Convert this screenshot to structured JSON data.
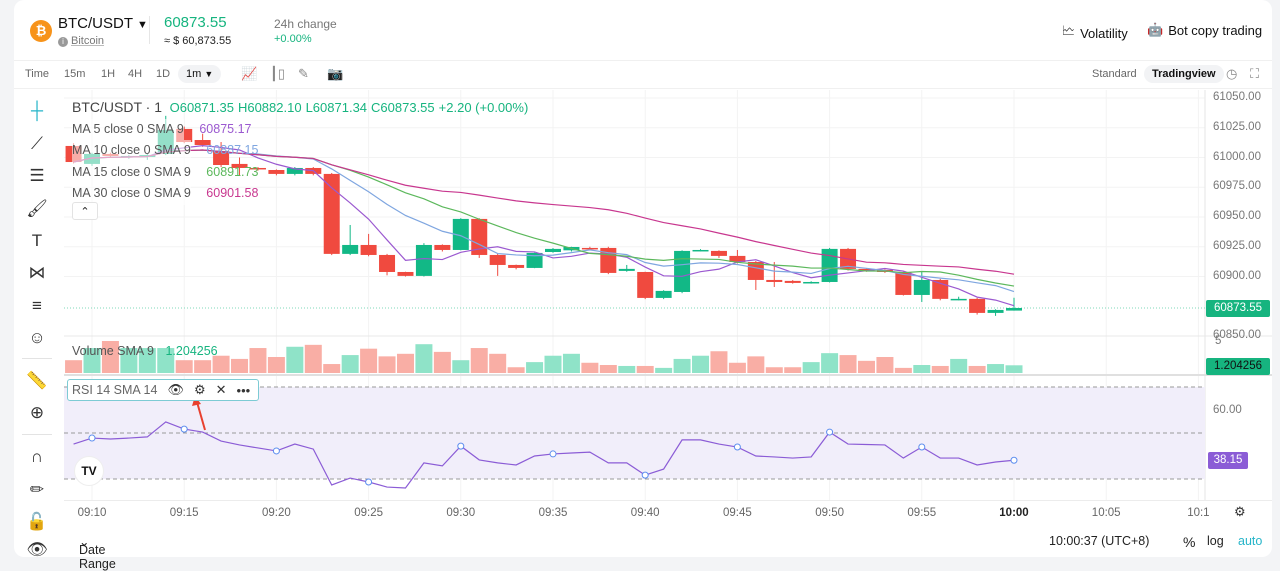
{
  "header": {
    "coin_icon": "bitcoin-icon",
    "pair": "BTC/USDT",
    "coin_name": "Bitcoin",
    "price": "60873.55",
    "price_usd": "≈ $ 60,873.55",
    "change_label": "24h change",
    "change_value": "+0.00%",
    "volatility": "Volatility",
    "bot_copy": "Bot copy trading"
  },
  "toolbar": {
    "intervals": [
      "Time",
      "15m",
      "1H",
      "4H",
      "1D"
    ],
    "selected_interval": "1m",
    "views": [
      "Standard",
      "Tradingview"
    ],
    "active_view": "Tradingview"
  },
  "legend": {
    "title": "BTC/USDT · 1",
    "o": "O60871.35",
    "h": "H60882.10",
    "l": "L60871.34",
    "c": "C60873.55",
    "chg": "+2.20 (+0.00%)",
    "ma": [
      {
        "label": "MA 5 close 0 SMA 9",
        "value": "60875.17",
        "color": "#9b59d0",
        "period": 5
      },
      {
        "label": "MA 10 close 0 SMA 9",
        "value": "60887.15",
        "color": "#7fa6e0",
        "period": 10
      },
      {
        "label": "MA 15 close 0 SMA 9",
        "value": "60891.73",
        "color": "#5cb85c",
        "period": 15
      },
      {
        "label": "MA 30 close 0 SMA 9",
        "value": "60901.58",
        "color": "#c8378f",
        "period": 30
      }
    ]
  },
  "volume": {
    "label": "Volume SMA 9",
    "value": "1.204256",
    "axis_label": "5"
  },
  "rsi": {
    "label": "RSI 14 SMA 14",
    "value": "38.15",
    "axis_label": "60.00",
    "bands": [
      70,
      50,
      30
    ]
  },
  "price_axis": [
    "61050.00",
    "61025.00",
    "61000.00",
    "60975.00",
    "60950.00",
    "60925.00",
    "60900.00",
    "60850.00"
  ],
  "current_price_tag": "60873.55",
  "time_axis": [
    "09:10",
    "09:15",
    "09:20",
    "09:25",
    "09:30",
    "09:35",
    "09:40",
    "09:45",
    "09:50",
    "09:55",
    "10:00",
    "10:05",
    "10:1"
  ],
  "bottom": {
    "date_range": "Date Range",
    "clock": "10:00:37 (UTC+8)",
    "percent": "%",
    "log": "log",
    "auto": "auto"
  },
  "colors": {
    "up": "#12b886",
    "down": "#f04a3f",
    "accent": "#26b5c9",
    "rsi": "#8b5cd6"
  },
  "chart_data": {
    "type": "candlestick",
    "columns": [
      "time",
      "open",
      "high",
      "low",
      "close",
      "volume",
      "rsi"
    ],
    "candles": [
      [
        "09:09",
        61009.7,
        61012,
        60995,
        60996.2,
        2.0,
        45.2
      ],
      [
        "09:10",
        60994.6,
        61004,
        60993,
        61003,
        3.9,
        47.8
      ],
      [
        "09:11",
        61003,
        61004,
        61000,
        61001.3,
        5.0,
        47.4
      ],
      [
        "09:12",
        61000.4,
        61002,
        60999,
        61001.3,
        3.9,
        47.8
      ],
      [
        "09:13",
        61000.4,
        61003,
        60998,
        61002.1,
        3.9,
        48.3
      ],
      [
        "09:14",
        61003,
        61035,
        61002,
        61023.1,
        3.9,
        54.8
      ],
      [
        "09:15",
        61024,
        61026,
        61012,
        61013,
        2.0,
        51.7
      ],
      [
        "09:16",
        61014.7,
        61020,
        61009,
        61010.5,
        2.0,
        50.4
      ],
      [
        "09:17",
        61005.5,
        61013,
        60992,
        60993.7,
        2.7,
        46.5
      ],
      [
        "09:18",
        60994.6,
        61000,
        60985.3,
        60991.2,
        2.2,
        44.8
      ],
      [
        "09:19",
        60991.2,
        60992,
        60989,
        60990,
        3.9,
        43.5
      ],
      [
        "09:20",
        60989.5,
        60990,
        60985,
        60986.2,
        2.5,
        42.2
      ],
      [
        "09:21",
        60986.2,
        60992,
        60985,
        60991.2,
        4.1,
        45.2
      ],
      [
        "09:22",
        60991.2,
        60992,
        60985,
        60986.2,
        4.4,
        43.0
      ],
      [
        "09:23",
        60986.2,
        60987,
        60918,
        60919,
        1.4,
        27.4
      ],
      [
        "09:24",
        60919,
        60943.3,
        60918,
        60926.5,
        2.8,
        30.4
      ],
      [
        "09:25",
        60926.5,
        60935.8,
        60917,
        60918.1,
        3.8,
        28.7
      ],
      [
        "09:26",
        60918.1,
        60919,
        60901,
        60903.8,
        2.6,
        26.5
      ],
      [
        "09:27",
        60903.8,
        60904,
        60900,
        60900.5,
        3.0,
        26.1
      ],
      [
        "09:28",
        60900.5,
        60928,
        60900,
        60926.5,
        4.5,
        37.0
      ],
      [
        "09:29",
        60926.5,
        60927,
        60921,
        60922.3,
        3.3,
        35.7
      ],
      [
        "09:30",
        60922.3,
        60949,
        60922,
        60948.4,
        2.0,
        44.3
      ],
      [
        "09:31",
        60948.4,
        60949,
        60915.6,
        60918.1,
        3.9,
        38.3
      ],
      [
        "09:32",
        60918.1,
        60919,
        60900.5,
        60909.7,
        3.0,
        37.0
      ],
      [
        "09:33",
        60909.7,
        60910,
        60906,
        60907.2,
        0.9,
        36.1
      ],
      [
        "09:34",
        60907.2,
        60920,
        60907,
        60919.8,
        1.7,
        40.0
      ],
      [
        "09:35",
        60920.6,
        60924,
        60920,
        60923.2,
        2.7,
        40.9
      ],
      [
        "09:36",
        60922,
        60925,
        60921,
        60924.8,
        3.0,
        41.3
      ],
      [
        "09:37",
        60924,
        60925,
        60923,
        60923.5,
        1.6,
        41.7
      ],
      [
        "09:38",
        60924,
        60925,
        60902,
        60903,
        1.25,
        37.0
      ],
      [
        "09:39",
        60904.7,
        60909.7,
        60904,
        60906.4,
        1.1,
        37.0
      ],
      [
        "09:40",
        60903.8,
        60904,
        60881,
        60882,
        1.1,
        31.7
      ],
      [
        "09:41",
        60882,
        60888.5,
        60881,
        60887.9,
        0.8,
        34.3
      ],
      [
        "09:42",
        60887,
        60922,
        60886,
        60921.5,
        2.2,
        47.0
      ],
      [
        "09:43",
        60921.5,
        60923,
        60921,
        60922.3,
        2.7,
        47.0
      ],
      [
        "09:44",
        60921.5,
        60922,
        60915.6,
        60917.3,
        3.4,
        45.2
      ],
      [
        "09:45",
        60917.3,
        60922.3,
        60911,
        60912.2,
        1.6,
        43.9
      ],
      [
        "09:46",
        60912.2,
        60913,
        60888.7,
        60897.1,
        2.6,
        40.0
      ],
      [
        "09:47",
        60897.1,
        60912.2,
        60891.2,
        60895.4,
        0.9,
        39.6
      ],
      [
        "09:48",
        60896.3,
        60897,
        60894,
        60894.6,
        0.9,
        39.1
      ],
      [
        "09:49",
        60894.6,
        60896,
        60894,
        60895.4,
        1.7,
        39.6
      ],
      [
        "09:50",
        60895.4,
        60924,
        60895,
        60923.2,
        3.1,
        50.4
      ],
      [
        "09:51",
        60923.2,
        60924,
        60905,
        60906.4,
        2.8,
        45.2
      ],
      [
        "09:52",
        60906.4,
        60907,
        60904,
        60904.7,
        1.9,
        45.0
      ],
      [
        "09:53",
        60905.5,
        60906,
        60903,
        60903.8,
        2.5,
        44.8
      ],
      [
        "09:54",
        60903.8,
        60904,
        60884,
        60884.5,
        0.8,
        39.1
      ],
      [
        "09:55",
        60884.5,
        60903.8,
        60878.6,
        60897.1,
        1.25,
        43.9
      ],
      [
        "09:56",
        60897.1,
        60898,
        60880,
        60881.2,
        1.1,
        39.1
      ],
      [
        "09:57",
        60880.3,
        60883,
        60880,
        60881.2,
        2.2,
        39.1
      ],
      [
        "09:58",
        60881.2,
        60882,
        60868,
        60869.4,
        1.1,
        36.1
      ],
      [
        "09:59",
        60869.4,
        60872.5,
        60866.9,
        60871.9,
        1.4,
        37.4
      ],
      [
        "10:00",
        60871.35,
        60882.1,
        60871.34,
        60873.55,
        1.204256,
        38.15
      ]
    ],
    "price_range": [
      60840,
      61057
    ],
    "volume_range": [
      0,
      5
    ],
    "rsi_range": [
      25,
      75
    ],
    "grid": true
  }
}
